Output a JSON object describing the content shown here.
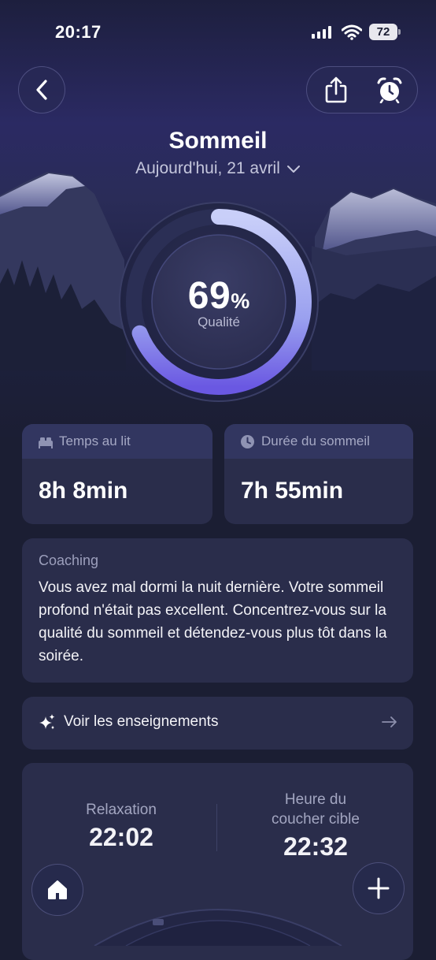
{
  "status_bar": {
    "time": "20:17",
    "battery": "72"
  },
  "header": {
    "title": "Sommeil",
    "date": "Aujourd'hui, 21 avril"
  },
  "quality": {
    "value": 69,
    "display": "69",
    "unit": "%",
    "label": "Qualité",
    "fraction": 0.69
  },
  "stats": [
    {
      "label": "Temps au lit",
      "value": "8h 8min",
      "icon": "bed-icon"
    },
    {
      "label": "Durée du sommeil",
      "value": "7h 55min",
      "icon": "clock-icon"
    }
  ],
  "coaching": {
    "title": "Coaching",
    "text": "Vous avez mal dormi la nuit dernière. Votre sommeil profond n'était pas excellent. Concentrez-vous sur la qualité du sommeil et détendez-vous plus tôt dans la soirée."
  },
  "insights": {
    "label": "Voir les enseignements",
    "icon": "sparkles-icon"
  },
  "schedule": {
    "relaxation_label": "Relaxation",
    "relaxation_time": "22:02",
    "bedtime_label_line1": "Heure du",
    "bedtime_label_line2": "coucher cible",
    "bedtime_time": "22:32"
  },
  "colors": {
    "background": "#1b1e33",
    "card": "#2a2d4b",
    "card_header": "#323660",
    "accent": "#7b6ee6",
    "accent_light": "#c8cdf8"
  }
}
